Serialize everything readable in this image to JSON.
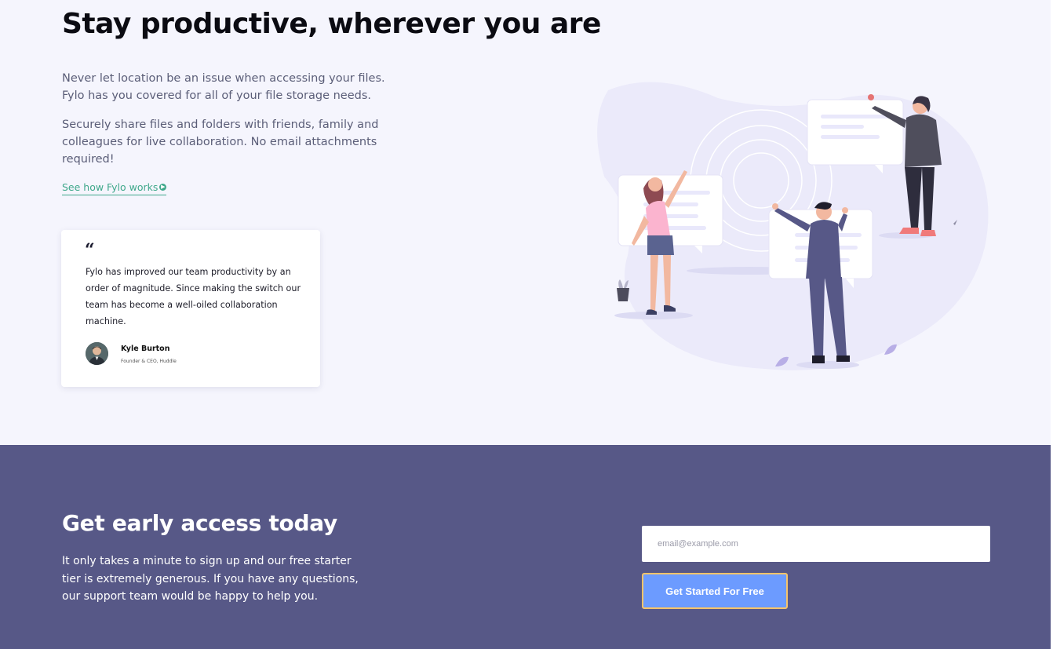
{
  "productive": {
    "headline": "Stay productive, wherever you are",
    "paragraph_1": "Never let location be an issue when accessing your files. Fylo has you covered for all of your file storage needs.",
    "paragraph_2": "Securely share files and folders with friends, family and colleagues for live collaboration. No email attachments required!",
    "link_label": "See how Fylo works",
    "link_icon": "arrow-circle-icon"
  },
  "testimonial": {
    "quote_mark": "“",
    "quote": "Fylo has improved our team productivity by an order of magnitude. Since making the switch our team has become a well-oiled collaboration machine.",
    "author_name": "Kyle Burton",
    "author_role": "Founder & CEO, Huddle"
  },
  "early_access": {
    "title": "Get early access today",
    "text": "It only takes a minute to sign up and our free starter tier is extremely generous. If you have any questions, our support team would be happy to help you.",
    "email_placeholder": "email@example.com",
    "button_label": "Get Started For Free"
  },
  "colors": {
    "page_bg": "#f5f5fd",
    "cta_bg": "#575887",
    "link": "#3fa88b",
    "button": "#6c9bff",
    "button_border": "#f6c46a"
  }
}
